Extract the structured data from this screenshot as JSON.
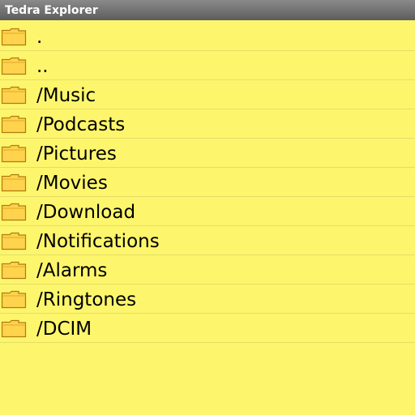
{
  "window": {
    "title": "Tedra Explorer"
  },
  "colors": {
    "background": "#fdf66c",
    "titlebar": "#6e6e6e",
    "folder_fill": "#ffd34d",
    "folder_stroke": "#b07a10"
  },
  "icons": {
    "folder": "folder-icon"
  },
  "list": {
    "items": [
      {
        "label": "."
      },
      {
        "label": ".."
      },
      {
        "label": "/Music"
      },
      {
        "label": "/Podcasts"
      },
      {
        "label": "/Pictures"
      },
      {
        "label": "/Movies"
      },
      {
        "label": "/Download"
      },
      {
        "label": "/Notifications"
      },
      {
        "label": "/Alarms"
      },
      {
        "label": "/Ringtones"
      },
      {
        "label": "/DCIM"
      }
    ]
  }
}
